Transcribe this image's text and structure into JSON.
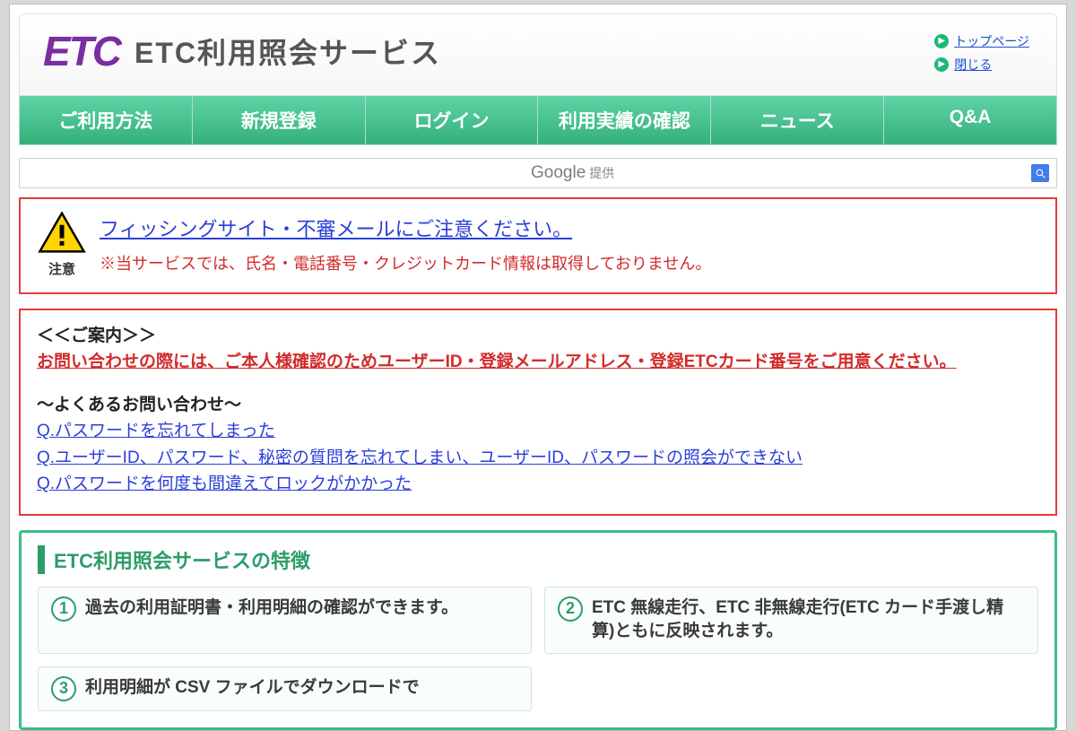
{
  "header": {
    "logo_text": "ETC",
    "title": "ETC利用照会サービス",
    "links": {
      "top": "トップページ",
      "close": "閉じる"
    }
  },
  "nav": {
    "items": [
      "ご利用方法",
      "新規登録",
      "ログイン",
      "利用実績の確認",
      "ニュース",
      "Q&A"
    ]
  },
  "search": {
    "provider": "Google",
    "provider_sub": "提供"
  },
  "alert": {
    "warn_label": "注意",
    "link": "フィッシングサイト・不審メールにご注意ください。",
    "sub": "※当サービスでは、氏名・電話番号・クレジットカード情報は取得しておりません。"
  },
  "info": {
    "guide_head": "＜＜ご案内＞＞",
    "red_line": "お問い合わせの際には、ご本人様確認のためユーザーID・登録メールアドレス・登録ETCカード番号をご用意ください。",
    "faq_head": "～よくあるお問い合わせ～",
    "faq": [
      "Q.パスワードを忘れてしまった",
      "Q.ユーザーID、パスワード、秘密の質問を忘れてしまい、ユーザーID、パスワードの照会ができない",
      "Q.パスワードを何度も間違えてロックがかかった"
    ]
  },
  "features": {
    "title": "ETC利用照会サービスの特徴",
    "cards": [
      {
        "num": "1",
        "text": "過去の利用証明書・利用明細の確認ができます。"
      },
      {
        "num": "2",
        "text": "ETC 無線走行、ETC 非無線走行(ETC カード手渡し精算)ともに反映されます。"
      },
      {
        "num": "3",
        "text": "利用明細が CSV ファイルでダウンロードで"
      }
    ]
  }
}
